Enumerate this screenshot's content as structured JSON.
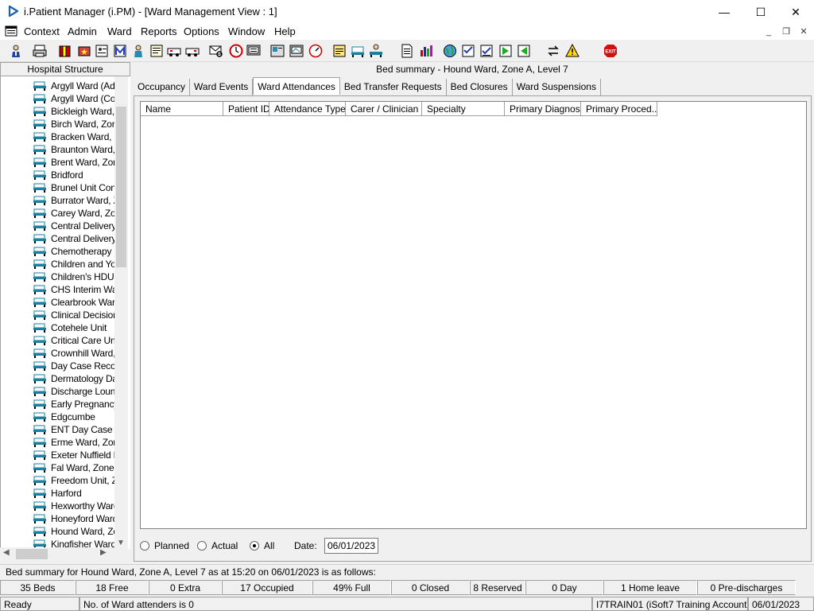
{
  "window": {
    "title": "i.Patient Manager (i.PM) - [Ward Management View : 1]",
    "minimize_glyph": "—",
    "maximize_glyph": "☐",
    "close_glyph": "✕"
  },
  "menu": {
    "items": [
      "Context",
      "Admin",
      "Ward",
      "Reports",
      "Options",
      "Window",
      "Help"
    ]
  },
  "toolbar": {
    "icons": [
      "person-icon",
      "printer-icon",
      "books-icon",
      "star-folder-icon",
      "document-person-icon",
      "m-icon",
      "doctor-icon",
      "notes-icon",
      "ambulance-icon",
      "ambulance-2-icon",
      "envelope-search-icon",
      "clock-icon",
      "monitor-icon",
      "card-icon",
      "card-2-icon",
      "dial-icon",
      "note-icon",
      "bed-icon",
      "user-bed-icon",
      "page-icon",
      "bar-chart-icon",
      "globe-icon",
      "checklist-icon",
      "checklist-2-icon",
      "green-arrow-icon",
      "green-arrow-2-icon",
      "swap-icon",
      "warning-icon",
      "exit-icon"
    ],
    "exit_label": "EXIT"
  },
  "left_pane": {
    "header": "Hospital Structure",
    "wards": [
      "Argyll Ward (Adul",
      "Argyll Ward (Cots",
      "Bickleigh Ward, Z",
      "Birch Ward, Zone",
      "Bracken Ward, Z",
      "Braunton Ward, Z",
      "Brent Ward, Zone",
      "Bridford",
      "Brunel Unit Conti",
      "Burrator Ward, Zo",
      "Carey Ward, Zon",
      "Central Delivery S",
      "Central Delivery S",
      "Chemotherapy Da",
      "Children and You",
      "Children's HDU (M",
      "CHS Interim Ward",
      "Clearbrook Ward",
      "Clinical Decision",
      "Cotehele Unit",
      "Critical Care Unit",
      "Crownhill Ward, Z",
      "Day Case Recov",
      "Dermatology Day",
      "Discharge Loung",
      "Early Pregnancy",
      "Edgcumbe",
      "ENT Day Case U",
      "Erme Ward, Zone",
      "Exeter Nuffield H",
      "Fal Ward, Zone E",
      "Freedom Unit, Zo",
      "Harford",
      "Hexworthy Ward,",
      "Honeyford Ward,",
      "Hound Ward, Zo",
      "Kingfisher Ward"
    ]
  },
  "right_pane": {
    "header": "Bed summary - Hound Ward, Zone A, Level 7",
    "tabs": [
      "Occupancy",
      "Ward Events",
      "Ward Attendances",
      "Bed Transfer Requests",
      "Bed Closures",
      "Ward Suspensions"
    ],
    "active_tab": "Ward Attendances",
    "columns": [
      "Name",
      "Patient ID",
      "Attendance Type",
      "Carer / Clinician",
      "Specialty",
      "Primary Diagnosis",
      "Primary Proced..."
    ],
    "filters": {
      "options": [
        "Planned",
        "Actual",
        "All"
      ],
      "selected": "All",
      "date_label": "Date:",
      "date_value": "06/01/2023"
    }
  },
  "summary": {
    "text": "Bed summary for Hound Ward, Zone A, Level 7 as at 15:20 on 06/01/2023 is as follows:",
    "stats": [
      "35 Beds",
      "18 Free",
      "0 Extra",
      "17 Occupied",
      "49% Full",
      "0 Closed",
      "8 Reserved",
      "0 Day",
      "1 Home leave",
      "0 Pre-discharges"
    ]
  },
  "statusbar": {
    "state": "Ready",
    "message": "No. of Ward attenders is 0",
    "user": "I7TRAIN01 (iSoft7 Training Account)",
    "date": "06/01/2023"
  },
  "colors": {
    "bed_icon": "#1a7fa0",
    "exit_red": "#d01010",
    "app_icon_blue": "#1f5fb3"
  }
}
